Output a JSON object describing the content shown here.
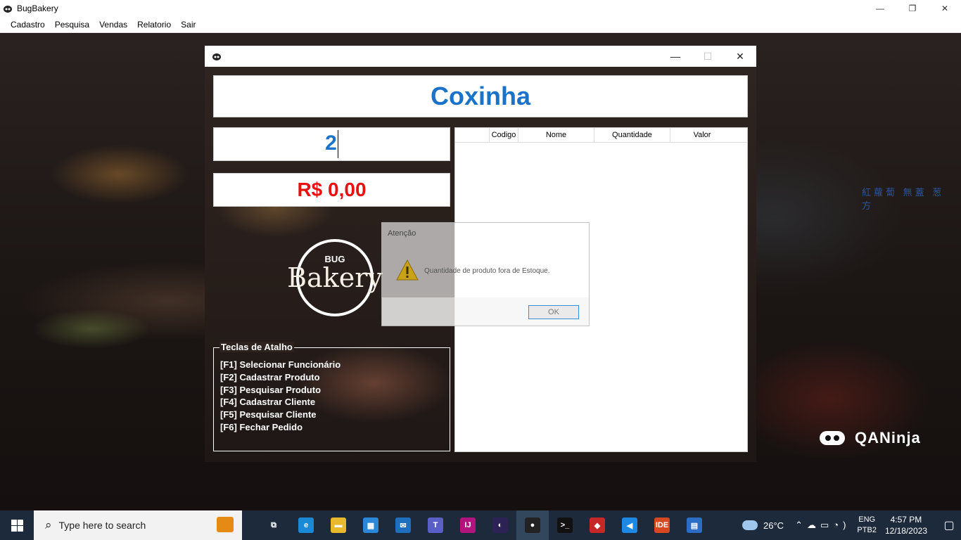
{
  "app": {
    "title": "BugBakery",
    "menu": [
      "Cadastro",
      "Pesquisa",
      "Vendas",
      "Relatorio",
      "Sair"
    ],
    "window_controls": {
      "minimize": "—",
      "restore": "❐",
      "close": "✕"
    }
  },
  "background": {
    "sign_text": "紅蘿蔔 無蓋 葱 方",
    "brand": "QANinja"
  },
  "sale_window": {
    "product_name": "Coxinha",
    "quantity": "2",
    "price": "R$ 0,00",
    "logo": {
      "top": "BUG",
      "word": "Bakery"
    },
    "shortcuts": {
      "title": "Teclas de Atalho",
      "items": [
        "[F1] Selecionar Funcionário",
        "[F2] Cadastrar Produto",
        "[F3] Pesquisar Produto",
        "[F4] Cadastrar Cliente",
        "[F5] Pesquisar Cliente",
        "[F6] Fechar Pedido"
      ]
    },
    "grid": {
      "columns": [
        "",
        "Codigo",
        "Nome",
        "Quantidade",
        "Valor"
      ],
      "rows": []
    }
  },
  "dialog": {
    "title": "Atenção",
    "message": "Quantidade de produto fora de Estoque.",
    "ok_label": "OK"
  },
  "taskbar": {
    "search_placeholder": "Type here to search",
    "pinned": [
      {
        "name": "task-view-icon",
        "glyph": "⧉",
        "color": "#1c2a3b"
      },
      {
        "name": "edge-icon",
        "glyph": "e",
        "color": "#1b8ad6"
      },
      {
        "name": "file-explorer-icon",
        "glyph": "▬",
        "color": "#e8b92c"
      },
      {
        "name": "store-icon",
        "glyph": "▦",
        "color": "#2b88d8"
      },
      {
        "name": "mail-icon",
        "glyph": "✉",
        "color": "#1f6fbf"
      },
      {
        "name": "teams-icon",
        "glyph": "T",
        "color": "#5a5fc8"
      },
      {
        "name": "intellij-icon",
        "glyph": "IJ",
        "color": "#b2147e"
      },
      {
        "name": "eclipse-icon",
        "glyph": "◐",
        "color": "#2c2255"
      },
      {
        "name": "bugbakery-icon",
        "glyph": "●",
        "color": "#222"
      },
      {
        "name": "terminal-icon",
        "glyph": ">_",
        "color": "#111"
      },
      {
        "name": "app-red-icon",
        "glyph": "◆",
        "color": "#c62828"
      },
      {
        "name": "vscode-icon",
        "glyph": "◀",
        "color": "#1e88e5"
      },
      {
        "name": "ide-icon",
        "glyph": "IDE",
        "color": "#d64820"
      },
      {
        "name": "document-icon",
        "glyph": "▤",
        "color": "#2b6cc4"
      }
    ],
    "weather_temp": "26°C",
    "lang_top": "ENG",
    "lang_bottom": "PTB2",
    "time": "4:57 PM",
    "date": "12/18/2023"
  }
}
